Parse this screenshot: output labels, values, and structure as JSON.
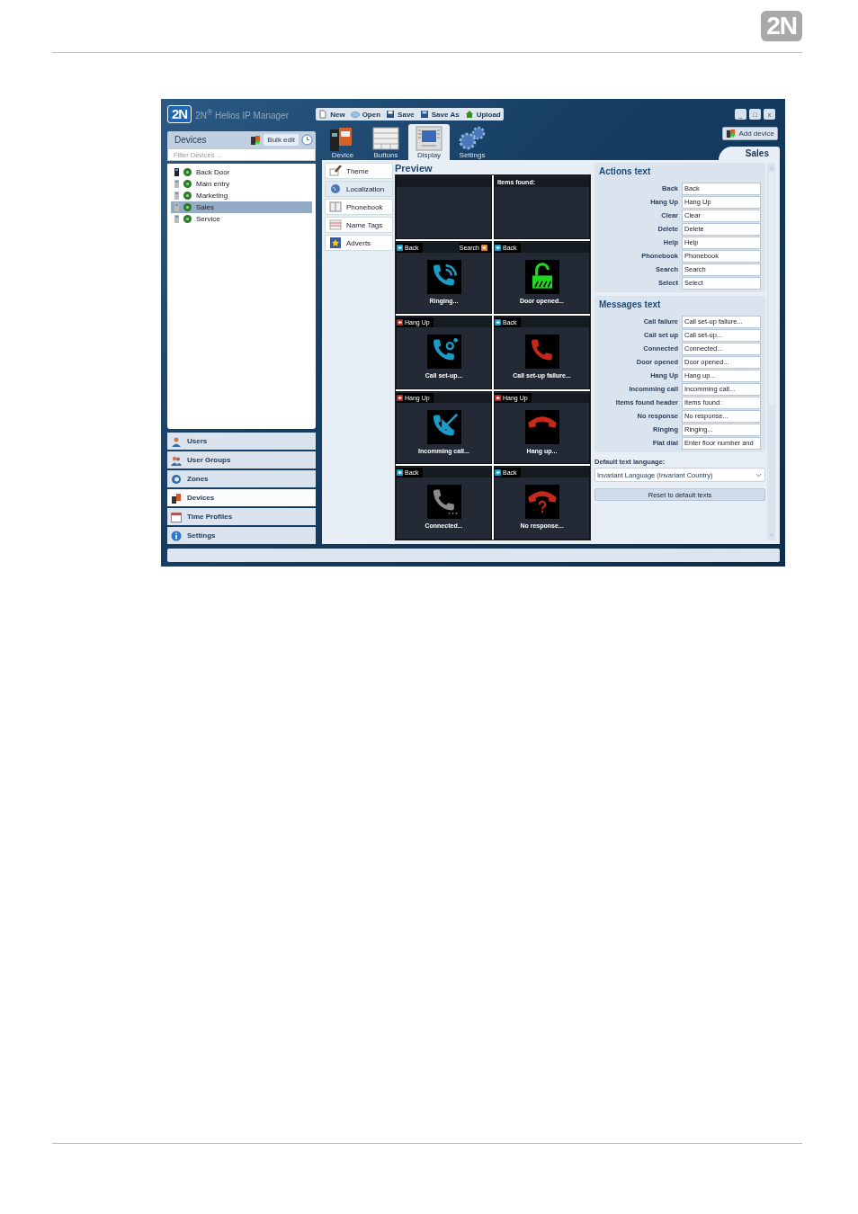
{
  "page_logo": "2N",
  "app": {
    "logo": "2N",
    "title": "2N$^{®}$ Helios IP Manager"
  },
  "toolbar": [
    {
      "label": "New",
      "kind": "new"
    },
    {
      "label": "Open",
      "kind": "open"
    },
    {
      "label": "Save",
      "kind": "save"
    },
    {
      "label": "Save As",
      "kind": "saveas"
    },
    {
      "label": "Upload",
      "kind": "upload"
    }
  ],
  "window_buttons": [
    "_",
    "□",
    "x"
  ],
  "devices_panel": {
    "title": "Devices",
    "bulk_edit": "Bulk edit",
    "filter_placeholder": "Filter Devices ...",
    "items": [
      {
        "name": "Back Door",
        "selected": false
      },
      {
        "name": "Main entry",
        "selected": false
      },
      {
        "name": "Marketing",
        "selected": false
      },
      {
        "name": "Sales",
        "selected": true
      },
      {
        "name": "Service",
        "selected": false
      }
    ]
  },
  "nav": [
    {
      "label": "Users",
      "kind": "users",
      "selected": false
    },
    {
      "label": "User Groups",
      "kind": "groups",
      "selected": false
    },
    {
      "label": "Zones",
      "kind": "zones",
      "selected": false
    },
    {
      "label": "Devices",
      "kind": "devices",
      "selected": true
    },
    {
      "label": "Time Profiles",
      "kind": "time",
      "selected": false
    },
    {
      "label": "Settings",
      "kind": "settings",
      "selected": false
    }
  ],
  "device_tabs": [
    {
      "label": "Device",
      "kind": "device",
      "selected": false
    },
    {
      "label": "Buttons",
      "kind": "buttons",
      "selected": false
    },
    {
      "label": "Display",
      "kind": "display",
      "selected": true
    },
    {
      "label": "Settings",
      "kind": "settings",
      "selected": false
    }
  ],
  "add_device": "Add device",
  "device_tab": "Sales",
  "sections": [
    {
      "label": "Theme",
      "kind": "theme",
      "selected": false
    },
    {
      "label": "Localization",
      "kind": "localization",
      "selected": true
    },
    {
      "label": "Phonebook",
      "kind": "phonebook",
      "selected": false
    },
    {
      "label": "Name Tags",
      "kind": "nametags",
      "selected": false
    },
    {
      "label": "Adverts",
      "kind": "adverts",
      "selected": false
    }
  ],
  "preview": {
    "title": "Preview",
    "screens": [
      {
        "kind": "list"
      },
      {
        "kind": "list",
        "header": "Items found:"
      },
      {
        "kind": "ringing",
        "left_key": {
          "label": "Back",
          "color": "#1b9cc6"
        },
        "right_key": {
          "label": "Search",
          "color": "#e67e22"
        },
        "caption": "Ringing..."
      },
      {
        "kind": "lock",
        "left_key": {
          "label": "Back",
          "color": "#1b9cc6"
        },
        "caption": "Door opened..."
      },
      {
        "kind": "setup",
        "left_key": {
          "label": "Hang Up",
          "color": "#c0261c"
        },
        "caption": "Call set-up..."
      },
      {
        "kind": "failure",
        "left_key": {
          "label": "Back",
          "color": "#1b9cc6"
        },
        "caption": "Call set-up failure..."
      },
      {
        "kind": "incoming",
        "left_key": {
          "label": "Hang Up",
          "color": "#c0261c"
        },
        "caption": "Incomming call..."
      },
      {
        "kind": "hangup",
        "left_key": {
          "label": "Hang Up",
          "color": "#c0261c"
        },
        "caption": "Hang up..."
      },
      {
        "kind": "connected",
        "left_key": {
          "label": "Back",
          "color": "#1b9cc6"
        },
        "caption": "Connected..."
      },
      {
        "kind": "noresponse",
        "left_key": {
          "label": "Back",
          "color": "#1b9cc6"
        },
        "caption": "No response..."
      }
    ]
  },
  "actions_text": {
    "title": "Actions text",
    "rows": [
      {
        "label": "Back",
        "value": "Back"
      },
      {
        "label": "Hang Up",
        "value": "Hang Up"
      },
      {
        "label": "Clear",
        "value": "Clear"
      },
      {
        "label": "Delete",
        "value": "Delete"
      },
      {
        "label": "Help",
        "value": "Help"
      },
      {
        "label": "Phonebook",
        "value": "Phonebook"
      },
      {
        "label": "Search",
        "value": "Search"
      },
      {
        "label": "Select",
        "value": "Select"
      }
    ]
  },
  "messages_text": {
    "title": "Messages text",
    "rows": [
      {
        "label": "Call failure",
        "value": "Call set-up failure..."
      },
      {
        "label": "Call set up",
        "value": "Call set-up..."
      },
      {
        "label": "Connected",
        "value": "Connected..."
      },
      {
        "label": "Door opened",
        "value": "Door opened..."
      },
      {
        "label": "Hang Up",
        "value": "Hang up..."
      },
      {
        "label": "Incomming call",
        "value": "Incomming call..."
      },
      {
        "label": "Items found header",
        "value": "Items found:"
      },
      {
        "label": "No response",
        "value": "No response..."
      },
      {
        "label": "Ringing",
        "value": "Ringing..."
      },
      {
        "label": "Flat dial",
        "value": "Enter floor number and"
      }
    ]
  },
  "default_language": {
    "label": "Default text language:",
    "value": "Invariant Language (Invariant Country)"
  },
  "reset_button": "Reset to default texts"
}
